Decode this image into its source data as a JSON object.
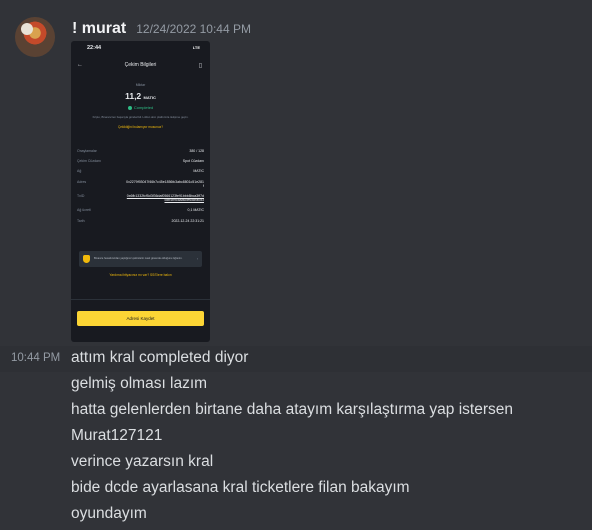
{
  "message": {
    "username": "! murat",
    "timestamp": "12/24/2022 10:44 PM",
    "hover_time": "10:44 PM"
  },
  "screenshot": {
    "status_time": "22:44",
    "status_right": "LTE",
    "title": "Çekim Bilgileri",
    "amount_label": "Miktar",
    "amount": "11,2",
    "currency": "MATIC",
    "status": "Completed",
    "note": "Kripto, Binance'ten başarıyla gönderildi. Lütfen alıcı platformla iletişime geçin.",
    "note_link": "Çekildiğini bulamıyor musunuz?",
    "rows": [
      {
        "key": "Onaylamalar",
        "value": "380 / 128"
      },
      {
        "key": "Çekim Cüzdanı",
        "value": "Spot Cüzdanı"
      },
      {
        "key": "Ağ",
        "value": "MATIC"
      },
      {
        "key": "Adres",
        "value": "0x2279f93047f46b7c45e1856fc3abc8801c51e281f"
      },
      {
        "key": "TxID",
        "value": "0x6fb1332fcf5d3f36daf0566123fe91bbb8bca3ff7dc8b4b9c8a86de6d8fa0d3"
      },
      {
        "key": "Ağ ücreti",
        "value": "0,1 MATIC"
      },
      {
        "key": "Tarih",
        "value": "2022-12-24 22:31:21"
      }
    ],
    "banner": "Binance hesabınızdan yaptığınız çekimlerin nasıl güvende olduğunu öğrenin.",
    "help": "Yardıma ihtiyacınız mı var? SSS'lere bakın",
    "cta": "Adresi Kaydet"
  },
  "lines": [
    "attım kral completed diyor",
    "gelmiş olması lazım",
    "hatta gelenlerden birtane daha atayım karşılaştırma yap istersen",
    "Murat127121",
    "verince yazarsın kral",
    "bide dcde ayarlasana kral ticketlere filan bakayım",
    "oyundayım"
  ]
}
